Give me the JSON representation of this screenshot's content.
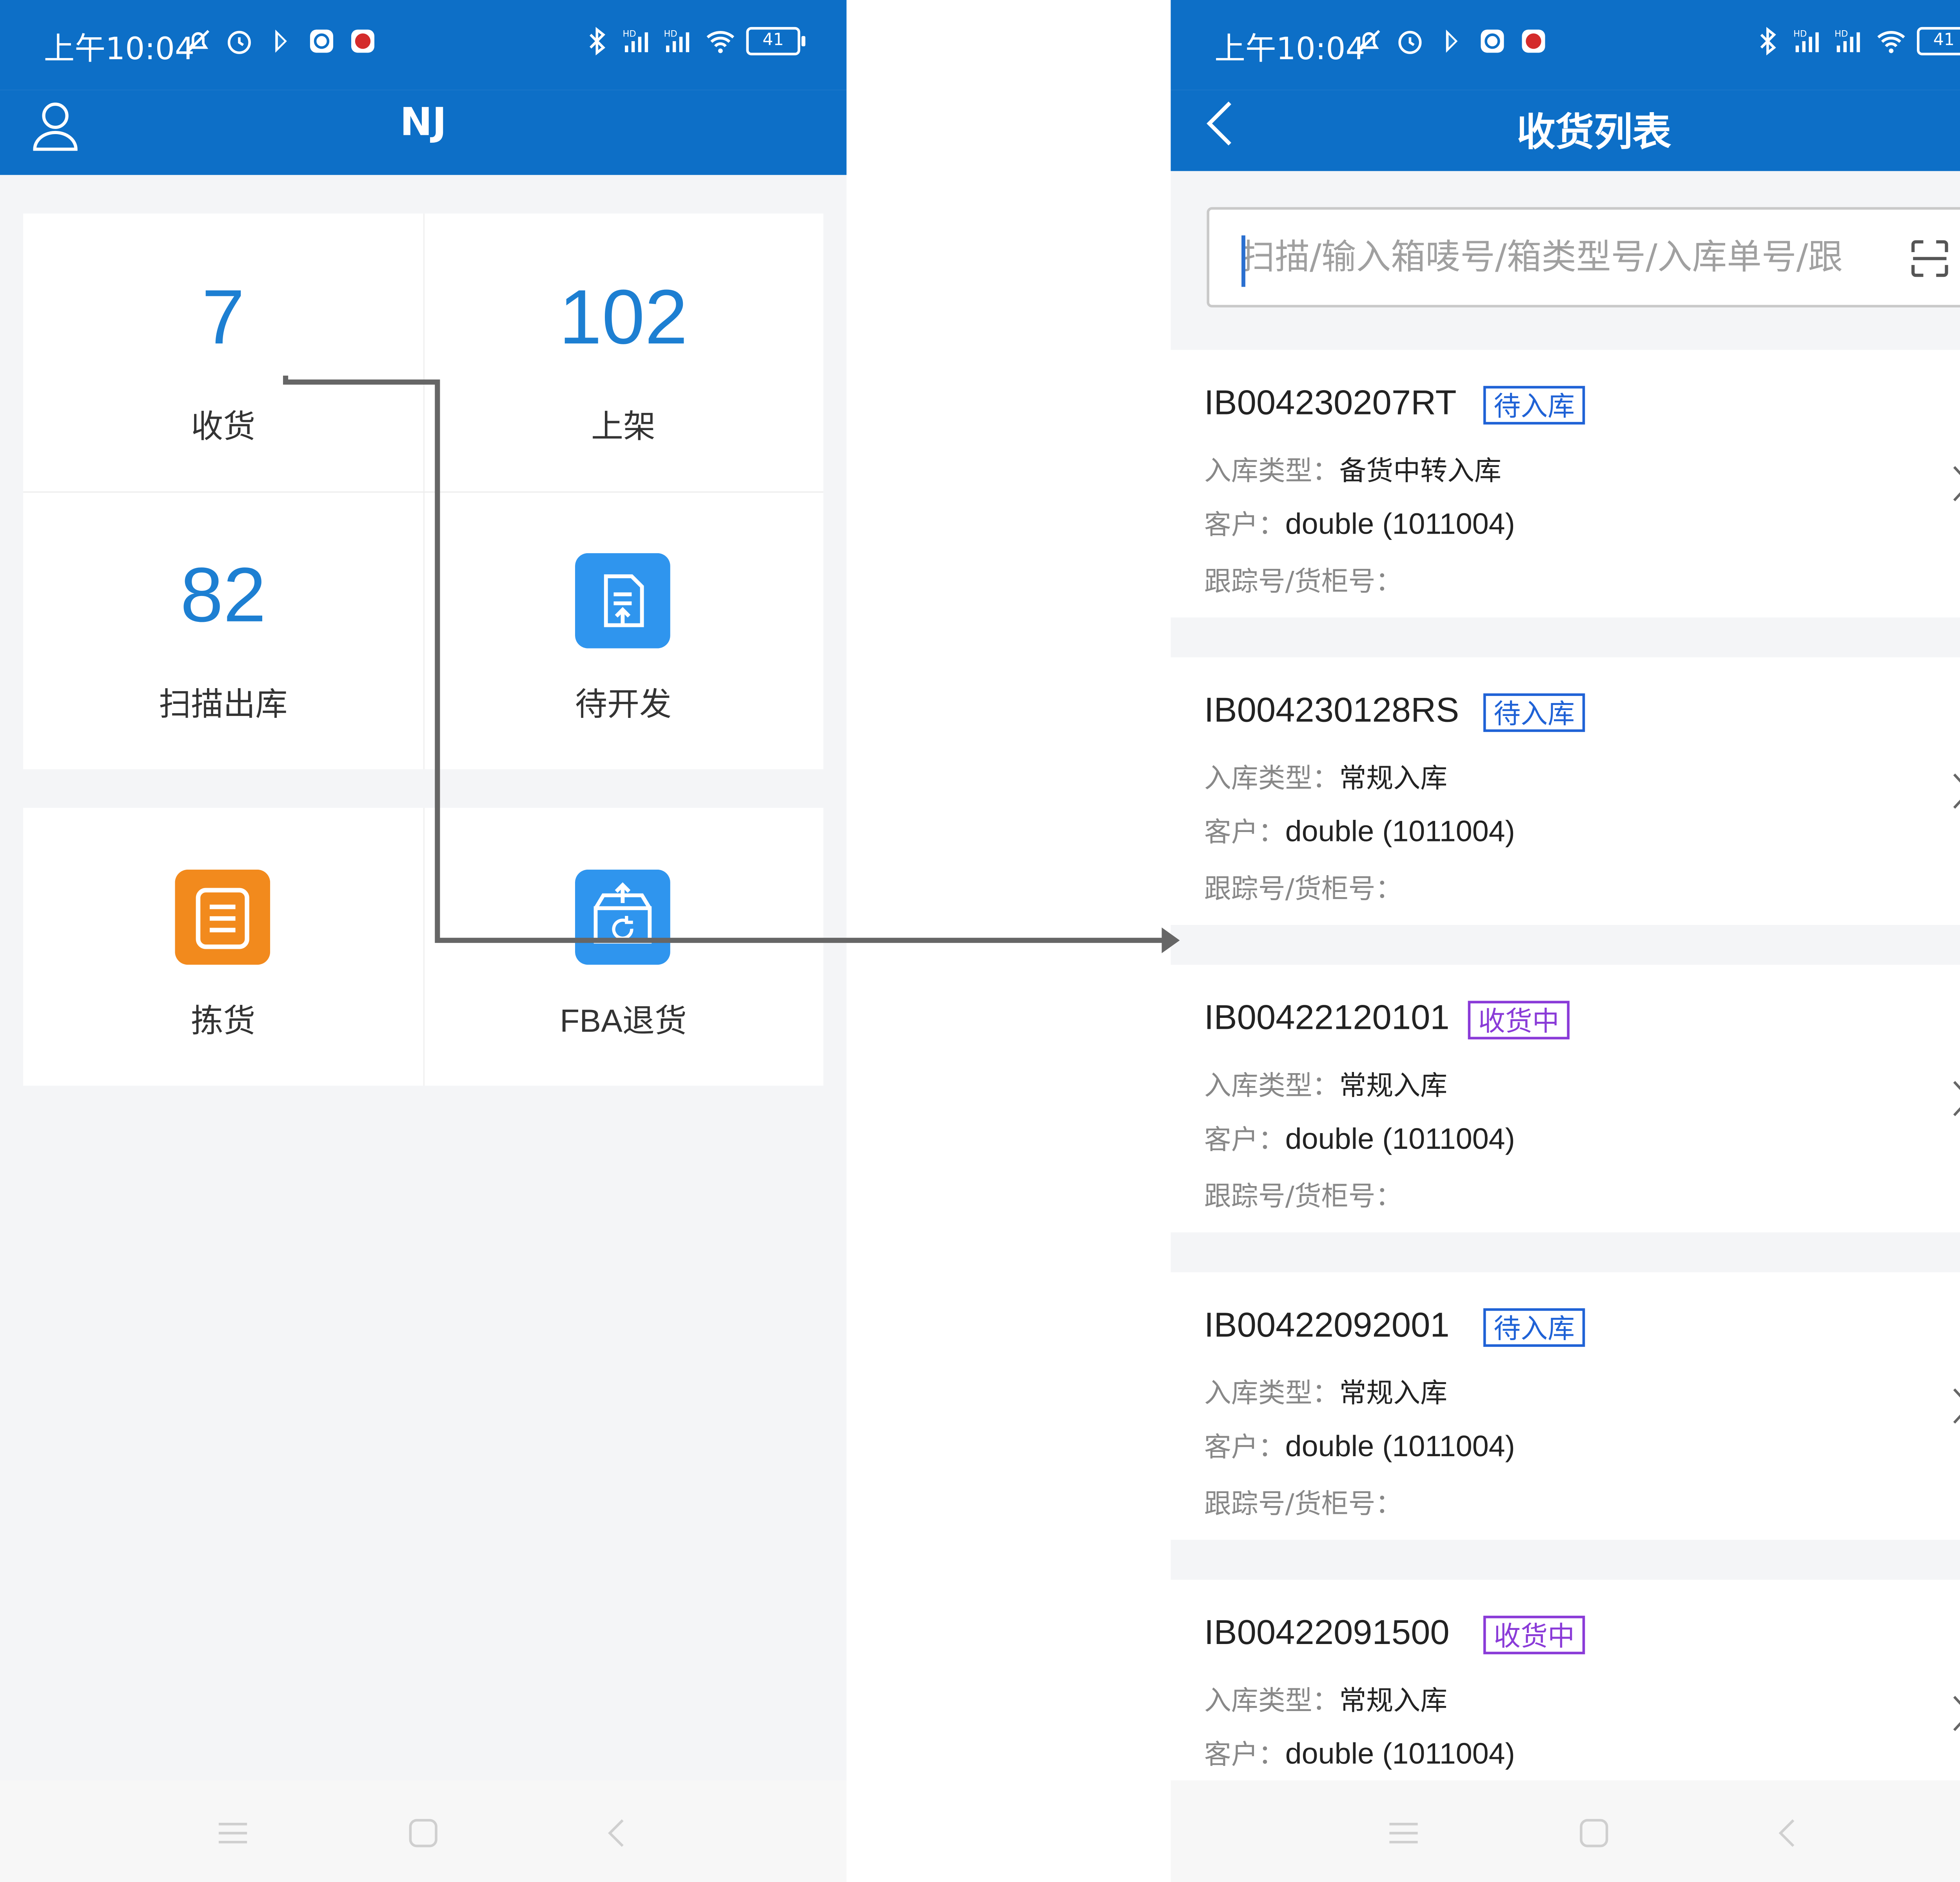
{
  "status_bar": {
    "time": "上午10:04",
    "battery": "41",
    "signal_badges": [
      "HD",
      "HD"
    ]
  },
  "home": {
    "title": "NJ",
    "tiles": [
      {
        "count": "7",
        "label": "收货"
      },
      {
        "count": "102",
        "label": "上架"
      },
      {
        "count": "82",
        "label": "扫描出库"
      },
      {
        "icon": "document-upload-icon",
        "label": "待开发"
      },
      {
        "icon": "clipboard-list-icon",
        "label": "拣货"
      },
      {
        "icon": "box-return-icon",
        "label": "FBA退货"
      }
    ]
  },
  "receiving_list": {
    "title": "收货列表",
    "search_placeholder": "扫描/输入箱唛号/箱类型号/入库单号/跟",
    "field_labels": {
      "type": "入库类型：",
      "customer": "客户：",
      "tracking": "跟踪号/货柜号："
    },
    "items": [
      {
        "id": "IB004230207RT",
        "status": "待入库",
        "type": "备货中转入库",
        "customer": "double (1011004)",
        "tracking": ""
      },
      {
        "id": "IB004230128RS",
        "status": "待入库",
        "type": "常规入库",
        "customer": "double (1011004)",
        "tracking": ""
      },
      {
        "id": "IB00422120101",
        "status": "收货中",
        "type": "常规入库",
        "customer": "double (1011004)",
        "tracking": ""
      },
      {
        "id": "IB00422092001",
        "status": "待入库",
        "type": "常规入库",
        "customer": "double (1011004)",
        "tracking": ""
      },
      {
        "id": "IB00422091500",
        "status": "收货中",
        "type": "常规入库",
        "customer": "double (1011004)",
        "tracking": ""
      }
    ]
  },
  "colors": {
    "brand_blue": "#0d6fc7",
    "count_blue": "#1d7fd2",
    "status_pending": "#1f62d6",
    "status_receiving": "#8a3bd8",
    "orange_icon": "#f28a1d",
    "blue_icon": "#2f95ee"
  }
}
